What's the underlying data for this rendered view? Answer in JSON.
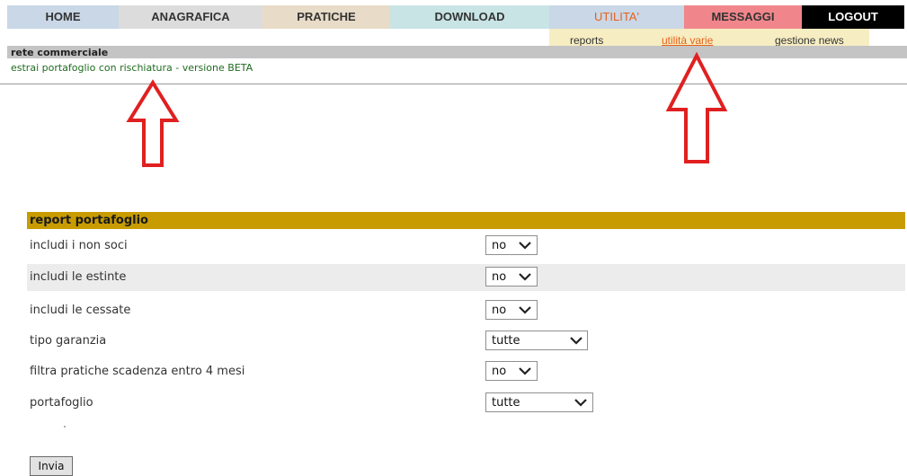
{
  "nav": {
    "items": [
      {
        "label": "HOME",
        "bg": "#c9d7e6",
        "color": "#333333"
      },
      {
        "label": "ANAGRAFICA",
        "bg": "#dcdcdc",
        "color": "#333333"
      },
      {
        "label": "PRATICHE",
        "bg": "#e8dcc8",
        "color": "#333333"
      },
      {
        "label": "DOWNLOAD",
        "bg": "#c8e4e4",
        "color": "#333333"
      },
      {
        "label": "UTILITA'",
        "bg": "#c9d7e6",
        "color": "#e8611a"
      },
      {
        "label": "MESSAGGI",
        "bg": "#f0868b",
        "color": "#333333"
      },
      {
        "label": "LOGOUT",
        "bg": "#000000",
        "color": "#ffffff"
      }
    ]
  },
  "submenu": {
    "items": [
      {
        "label": "reports",
        "active": false
      },
      {
        "label": "utilità varie",
        "active": true
      },
      {
        "label": "gestione news",
        "active": false
      }
    ],
    "active_color": "#e8611a"
  },
  "section": {
    "title": "rete commerciale",
    "link": "estrai portafoglio con rischiatura - versione BETA"
  },
  "annotations": {
    "arrow_color": "#e02020",
    "arrow_icon": "arrow-up-outline-icon"
  },
  "report": {
    "title": "report portafoglio",
    "header_color": "#c89c00",
    "rows": [
      {
        "label": "includi i non soci",
        "value": "no"
      },
      {
        "label": "includi le estinte",
        "value": "no"
      },
      {
        "label": "includi le cessate",
        "value": "no"
      },
      {
        "label": "tipo garanzia",
        "value": "tutte"
      },
      {
        "label": "filtra pratiche scadenza entro 4 mesi",
        "value": "no"
      },
      {
        "label": "portafoglio",
        "value": "tutte"
      }
    ],
    "submit_label": "Invia"
  }
}
